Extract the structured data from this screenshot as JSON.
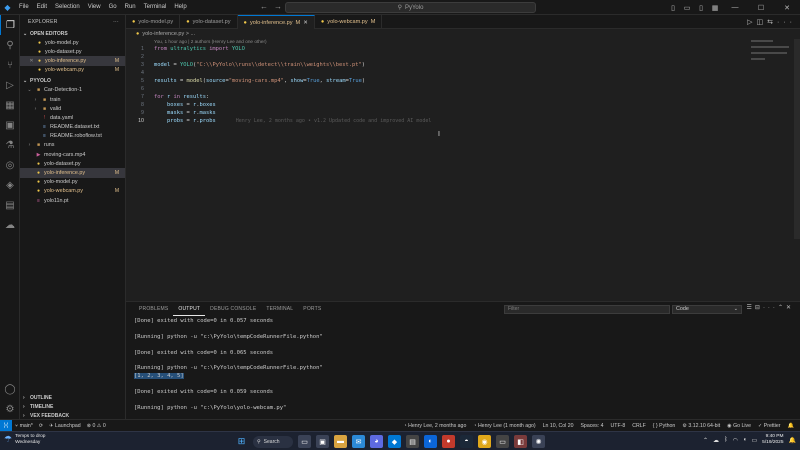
{
  "titlebar": {
    "menus": [
      "File",
      "Edit",
      "Selection",
      "View",
      "Go",
      "Run",
      "Terminal",
      "Help"
    ],
    "search": "PyYolo"
  },
  "explorer": {
    "title": "EXPLORER",
    "open_editors_label": "OPEN EDITORS",
    "open_editors": [
      {
        "name": "yolo-model.py",
        "modified": false
      },
      {
        "name": "yolo-dataset.py",
        "modified": false
      },
      {
        "name": "yolo-inference.py",
        "modified": true,
        "badge": "M",
        "active": true
      },
      {
        "name": "yolo-webcam.py",
        "modified": true,
        "badge": "M"
      }
    ],
    "project_label": "PYYOLO",
    "tree": [
      {
        "name": "Car-Detection-1",
        "type": "folder",
        "depth": 1,
        "open": true
      },
      {
        "name": "train",
        "type": "folder",
        "depth": 2
      },
      {
        "name": "valid",
        "type": "folder",
        "depth": 2
      },
      {
        "name": "data.yaml",
        "type": "yaml",
        "depth": 2
      },
      {
        "name": "README.dataset.txt",
        "type": "txt",
        "depth": 2
      },
      {
        "name": "README.roboflow.txt",
        "type": "txt",
        "depth": 2
      },
      {
        "name": "runs",
        "type": "folder",
        "depth": 1
      },
      {
        "name": "moving-cars.mp4",
        "type": "mp4",
        "depth": 1
      },
      {
        "name": "yolo-dataset.py",
        "type": "py",
        "depth": 1
      },
      {
        "name": "yolo-inference.py",
        "type": "py",
        "depth": 1,
        "modified": true,
        "badge": "M",
        "selected": true
      },
      {
        "name": "yolo-model.py",
        "type": "py",
        "depth": 1
      },
      {
        "name": "yolo-webcam.py",
        "type": "py",
        "depth": 1,
        "modified": true,
        "badge": "M"
      },
      {
        "name": "yolo11n.pt",
        "type": "pt",
        "depth": 1
      }
    ],
    "outline": "OUTLINE",
    "timeline": "TIMELINE",
    "vex": "VEX FEEDBACK"
  },
  "tabs": [
    {
      "name": "yolo-model.py",
      "active": false,
      "badge": ""
    },
    {
      "name": "yolo-dataset.py",
      "active": false,
      "badge": ""
    },
    {
      "name": "yolo-inference.py",
      "active": true,
      "badge": "M"
    },
    {
      "name": "yolo-webcam.py",
      "active": false,
      "badge": "M"
    }
  ],
  "breadcrumb": "yolo-inference.py > ...",
  "editor": {
    "blame_top": "You, 1 hour ago | 2 authors (Henry Lee and one other)",
    "line_numbers": [
      "1",
      "2",
      "3",
      "4",
      "5",
      "6",
      "7",
      "8",
      "9",
      "10"
    ],
    "inline_blame": "Henry Lee, 2 months ago • v1.2 Updated code and improved AI model"
  },
  "panel": {
    "tabs": [
      "PROBLEMS",
      "OUTPUT",
      "DEBUG CONSOLE",
      "TERMINAL",
      "PORTS"
    ],
    "active_tab": "OUTPUT",
    "filter_placeholder": "Filter",
    "channel": "Code",
    "lines": [
      "[Done] exited with code=0 in 0.057 seconds",
      "",
      "[Running] python -u \"c:\\PyYolo\\tempCodeRunnerFile.python\"",
      "",
      "[Done] exited with code=0 in 0.065 seconds",
      "",
      "[Running] python -u \"c:\\PyYolo\\tempCodeRunnerFile.python\"",
      "[1, 2, 3, 4, 5]",
      "",
      "[Done] exited with code=0 in 0.059 seconds",
      "",
      "[Running] python -u \"c:\\PyYolo\\yolo-webcam.py\""
    ]
  },
  "status": {
    "branch": "main*",
    "launchpad": "Launchpad",
    "problems": "⊗ 0 ⚠ 0",
    "blame": "Henry Lee, 2 months ago",
    "blame2": "Henry Lee (1 month ago)",
    "position": "Ln 10, Col 20",
    "spaces": "Spaces: 4",
    "encoding": "UTF-8",
    "eol": "CRLF",
    "language": "Python",
    "interpreter": "3.12.10 64-bit",
    "golive": "Go Live",
    "prettier": "Prettier"
  },
  "taskbar": {
    "weather_line1": "Temps to drop",
    "weather_line2": "Wednesday",
    "search": "Search",
    "time": "9:40 PM",
    "date": "5/19/2025"
  }
}
